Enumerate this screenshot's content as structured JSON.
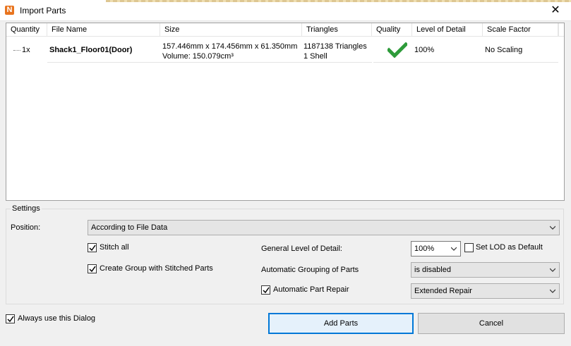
{
  "window": {
    "title": "Import Parts",
    "app_icon_letter": "N",
    "close_glyph": "✕"
  },
  "table": {
    "columns": [
      "Quantity",
      "File Name",
      "Size",
      "Triangles",
      "Quality",
      "Level of Detail",
      "Scale Factor"
    ],
    "rows": [
      {
        "quantity": "1x",
        "file_name": "Shack1_Floor01(Door)",
        "size_line1": "157.446mm x 174.456mm x 61.350mm",
        "size_line2": "Volume: 150.079cm³",
        "triangles_line1": "1187138 Triangles",
        "triangles_line2": "1 Shell",
        "quality_icon": "checkmark-icon",
        "quality_color": "#2e9b3a",
        "level_of_detail": "100%",
        "scale_factor": "No Scaling"
      }
    ]
  },
  "settings": {
    "legend": "Settings",
    "position_label": "Position:",
    "position_value": "According to File Data",
    "stitch_all_label": "Stitch all",
    "stitch_all_checked": true,
    "create_group_label": "Create Group with Stitched Parts",
    "create_group_checked": true,
    "general_lod_label": "General Level of Detail:",
    "general_lod_value": "100%",
    "set_lod_default_label": "Set LOD as Default",
    "set_lod_default_checked": false,
    "auto_grouping_label": "Automatic Grouping of Parts",
    "auto_grouping_value": "is disabled",
    "auto_repair_label": "Automatic Part Repair",
    "auto_repair_checked": true,
    "repair_mode_value": "Extended Repair"
  },
  "footer": {
    "always_use_label": "Always use this Dialog",
    "always_use_checked": true,
    "add_parts_label": "Add Parts",
    "cancel_label": "Cancel"
  },
  "colors": {
    "accent": "#0078d7",
    "app_icon": "#e8741e"
  }
}
